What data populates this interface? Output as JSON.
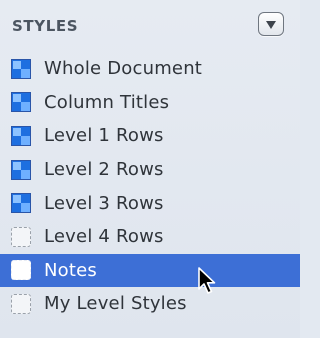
{
  "header": {
    "title": "STYLES",
    "menu_icon": "triangle-down-icon"
  },
  "styles": [
    {
      "label": "Whole Document",
      "swatch": "filled-style-icon",
      "selected": false
    },
    {
      "label": "Column Titles",
      "swatch": "filled-style-icon",
      "selected": false
    },
    {
      "label": "Level 1 Rows",
      "swatch": "filled-style-icon",
      "selected": false
    },
    {
      "label": "Level 2 Rows",
      "swatch": "filled-style-icon",
      "selected": false
    },
    {
      "label": "Level 3 Rows",
      "swatch": "filled-style-icon",
      "selected": false
    },
    {
      "label": "Level 4 Rows",
      "swatch": "empty-style-icon",
      "selected": false
    },
    {
      "label": "Notes",
      "swatch": "empty-style-icon",
      "selected": true
    },
    {
      "label": "My Level Styles",
      "swatch": "empty-style-icon",
      "selected": false
    }
  ],
  "colors": {
    "panel_background": "#e3e9f1",
    "selection": "#3d6fd6",
    "text": "#2f343a",
    "header_text": "#4c5561",
    "swatch_blue": "#1e6fe0"
  },
  "pointer": "arrow-cursor-icon"
}
